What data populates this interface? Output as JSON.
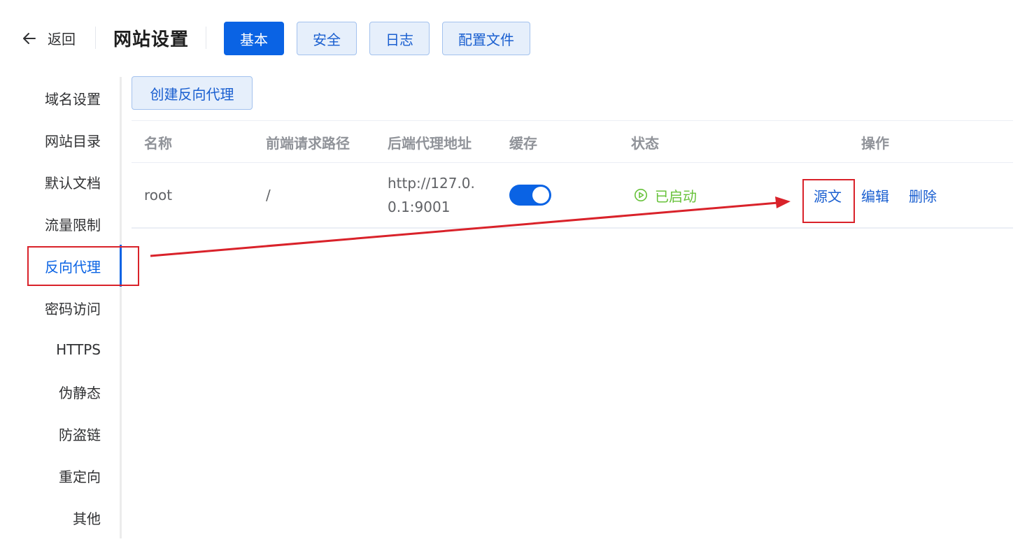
{
  "header": {
    "back_label": "返回",
    "title": "网站设置",
    "tabs": [
      {
        "label": "基本",
        "active": true
      },
      {
        "label": "安全",
        "active": false
      },
      {
        "label": "日志",
        "active": false
      },
      {
        "label": "配置文件",
        "active": false
      }
    ]
  },
  "sidebar": {
    "items": [
      {
        "label": "域名设置",
        "active": false
      },
      {
        "label": "网站目录",
        "active": false
      },
      {
        "label": "默认文档",
        "active": false
      },
      {
        "label": "流量限制",
        "active": false
      },
      {
        "label": "反向代理",
        "active": true
      },
      {
        "label": "密码访问",
        "active": false
      },
      {
        "label": "HTTPS",
        "active": false
      },
      {
        "label": "伪静态",
        "active": false
      },
      {
        "label": "防盗链",
        "active": false
      },
      {
        "label": "重定向",
        "active": false
      },
      {
        "label": "其他",
        "active": false
      }
    ]
  },
  "main": {
    "create_button": "创建反向代理",
    "table": {
      "columns": [
        "名称",
        "前端请求路径",
        "后端代理地址",
        "缓存",
        "状态",
        "操作"
      ],
      "rows": [
        {
          "name": "root",
          "path": "/",
          "proxy": "http://127.0.0.1:9001",
          "cache_enabled": true,
          "status": "已启动",
          "actions": [
            "源文",
            "编辑",
            "删除"
          ]
        }
      ]
    }
  },
  "colors": {
    "primary": "#0a63e4",
    "annotation": "#d9222a",
    "status_ok": "#67c23a"
  }
}
